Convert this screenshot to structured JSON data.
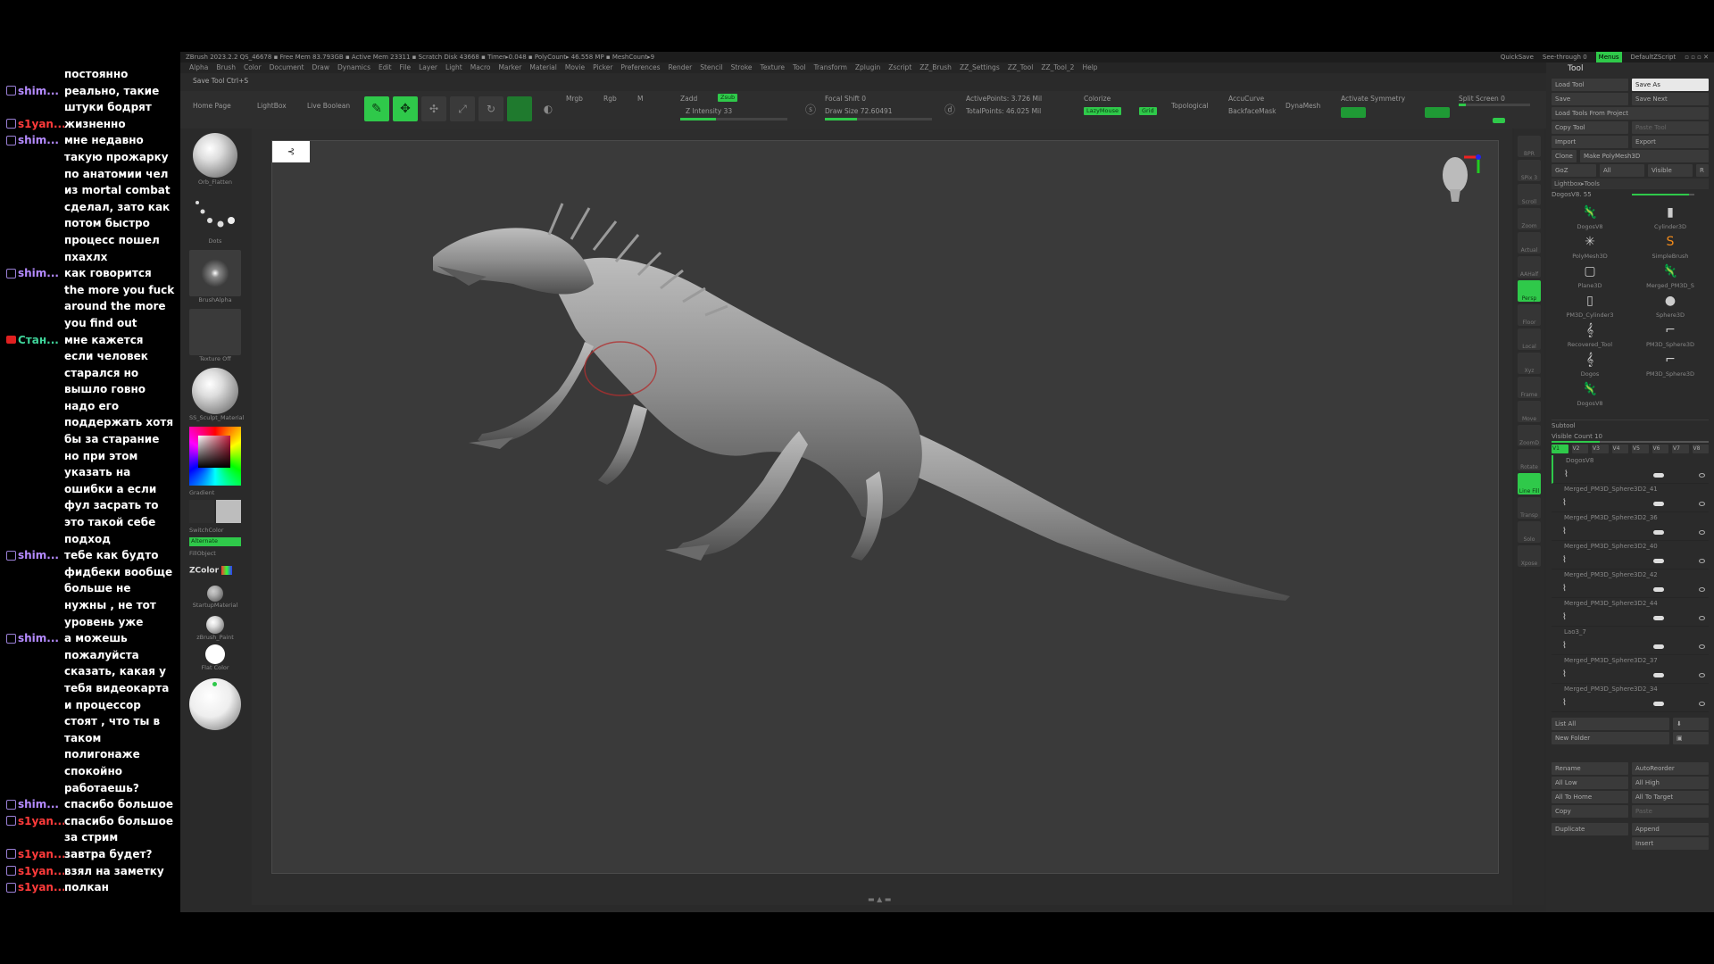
{
  "chat": [
    {
      "user": "",
      "color": "none",
      "badge": "none",
      "text": "постоянно"
    },
    {
      "user": "shim...",
      "color": "purple",
      "badge": "sq",
      "text": "реально, такие штуки бодрят"
    },
    {
      "user": "s1yan...",
      "color": "red",
      "badge": "sq",
      "text": "жизненно"
    },
    {
      "user": "shim...",
      "color": "purple",
      "badge": "sq",
      "text": "мне недавно такую прожарку по анатомии чел из mortal combat сделал, зато как потом быстро процесс пошел пхахлх"
    },
    {
      "user": "shim...",
      "color": "purple",
      "badge": "sq",
      "text": "как говорится the more you fuck around the more you find out"
    },
    {
      "user": "Стан...",
      "color": "teal",
      "badge": "red",
      "text": "мне кажется если человек старался но вышло говно надо его поддержать хотя бы за старание но при этом указать на ошибки а если фул засрать то это такой себе подход"
    },
    {
      "user": "shim...",
      "color": "purple",
      "badge": "sq",
      "text": "тебе как будто фидбеки вообще больше не нужны , не тот уровень уже"
    },
    {
      "user": "shim...",
      "color": "purple",
      "badge": "sq",
      "text": "а можешь пожалуйста сказать, какая у тебя видеокарта и процессор стоят , что ты в таком полигонаже спокойно работаешь?"
    },
    {
      "user": "shim...",
      "color": "purple",
      "badge": "sq",
      "text": "спасибо большое"
    },
    {
      "user": "s1yan...",
      "color": "red",
      "badge": "sq",
      "text": "спасибо большое за стрим"
    },
    {
      "user": "s1yan...",
      "color": "red",
      "badge": "sq",
      "text": "завтра будет?"
    },
    {
      "user": "s1yan...",
      "color": "red",
      "badge": "sq",
      "text": "взял на заметку"
    },
    {
      "user": "s1yan...",
      "color": "red",
      "badge": "sq",
      "text": "полкан"
    }
  ],
  "titlebar": {
    "text": "ZBrush 2023.2.2   QS_46678  ▪ Free Mem 83.793GB ▪ Active Mem 23311 ▪ Scratch Disk 43668 ▪ Timer▸0.048 ▪ PolyCount▸ 46.558 MP ▪ MeshCount▸9",
    "quicksave": "QuickSave",
    "seethrough": "See-through  0",
    "menus": "Menus",
    "script": "DefaultZScript"
  },
  "menus": [
    "Alpha",
    "Brush",
    "Color",
    "Document",
    "Draw",
    "Dynamics",
    "Edit",
    "File",
    "Layer",
    "Light",
    "Macro",
    "Marker",
    "Material",
    "Movie",
    "Picker",
    "Preferences",
    "Render",
    "Stencil",
    "Stroke",
    "Texture",
    "Tool",
    "Transform",
    "Zplugin",
    "Zscript",
    "ZZ_Brush",
    "ZZ_Settings",
    "ZZ_Tool",
    "ZZ_Tool_2",
    "Help"
  ],
  "tool_title": "Tool",
  "save_tool": "Save Tool Ctrl+S",
  "topbar": {
    "home": "Home Page",
    "lightbox": "LightBox",
    "live_boolean": "Live Boolean",
    "edit": "Edit",
    "draw": "Draw",
    "move": "Move",
    "scale": "Scale",
    "rotate": "Rotate",
    "mrgb": "Mrgb",
    "rgb": "Rgb",
    "m": "M",
    "zadd": "Zadd",
    "zsub": "Zsub",
    "z_intensity": "Z Intensity 33",
    "focal_shift": "Focal Shift 0",
    "draw_size": "Draw Size 72.60491",
    "active_points": "ActivePoints: 3.726 Mil",
    "total_points": "TotalPoints: 46.025 Mil",
    "colorize": "Colorize",
    "lazymouse": "LazyMouse",
    "grid": "Grid",
    "topological": "Topological",
    "accucurve": "AccuCurve",
    "backface": "BackfaceMask",
    "dynamesh": "DynaMesh",
    "activate_symmetry": "Activate Symmetry",
    "split_screen": "Split Screen  0"
  },
  "lefttray": {
    "brush": "Orb_Flatten",
    "stroke": "Dots",
    "alpha": "BrushAlpha",
    "texture": "Texture Off",
    "material": "SS_Sculpt_Material",
    "gradient": "Gradient",
    "switch": "SwitchColor",
    "alternate": "Alternate",
    "fillobject": "FillObject",
    "zcolor": "ZColor",
    "startup": "StartupMaterial",
    "zpaint": "zBrush_Paint",
    "flat": "Flat Color"
  },
  "rightshelf": [
    "BPR",
    "SPix 3",
    "Scroll",
    "Zoom",
    "Actual",
    "AAHalf",
    "Persp",
    "Floor",
    "Local",
    "Xyz",
    "Frame",
    "Move",
    "ZoomD",
    "Rotate",
    "Line Fill",
    "Transp",
    "Solo",
    "Xpose"
  ],
  "toolpanel": {
    "load_tool": "Load Tool",
    "save_as": "Save As",
    "save": "Save",
    "save_next": "Save Next",
    "load_project": "Load Tools From Project",
    "copy_tool": "Copy Tool",
    "paste_tool": "Paste Tool",
    "import": "Import",
    "export": "Export",
    "clone": "Clone",
    "make_polymesh": "Make PolyMesh3D",
    "goz": "GoZ",
    "all": "All",
    "visible": "Visible",
    "r": "R",
    "lightbox_tools": "Lightbox▸Tools",
    "dogosv8": "DogosV8. 55",
    "thumbs": [
      "DogosV8",
      "Cylinder3D",
      "PolyMesh3D",
      "SimpleBrush",
      "Plane3D",
      "Merged_PM3D_S",
      "PM3D_Cylinder3",
      "Sphere3D",
      "Recovered_Tool",
      "PM3D_Sphere3D",
      "Dogos",
      "PM3D_Sphere3D",
      "DogosV8",
      ""
    ],
    "subtool_header": "Subtool",
    "visible_count": "Visible Count 10",
    "v_tabs": [
      "V1",
      "V2",
      "V3",
      "V4",
      "V5",
      "V6",
      "V7",
      "V8"
    ],
    "subtools": [
      "DogosV8",
      "Merged_PM3D_Sphere3D2_41",
      "Merged_PM3D_Sphere3D2_36",
      "Merged_PM3D_Sphere3D2_40",
      "Merged_PM3D_Sphere3D2_42",
      "Merged_PM3D_Sphere3D2_44",
      "Lao3_7",
      "Merged_PM3D_Sphere3D2_37",
      "Merged_PM3D_Sphere3D2_34"
    ],
    "list_all": "List All",
    "new_folder": "New Folder",
    "rename": "Rename",
    "autoreorder": "AutoReorder",
    "all_low": "All Low",
    "all_high": "All High",
    "all_to_home": "All To Home",
    "all_to_target": "All To Target",
    "copy": "Copy",
    "paste": "Paste",
    "duplicate": "Duplicate",
    "append": "Append",
    "insert": "Insert"
  },
  "colors": {
    "accent": "#2fc94a",
    "purple": "#b58bff",
    "red": "#ff3b3b",
    "teal": "#3fd49a"
  }
}
